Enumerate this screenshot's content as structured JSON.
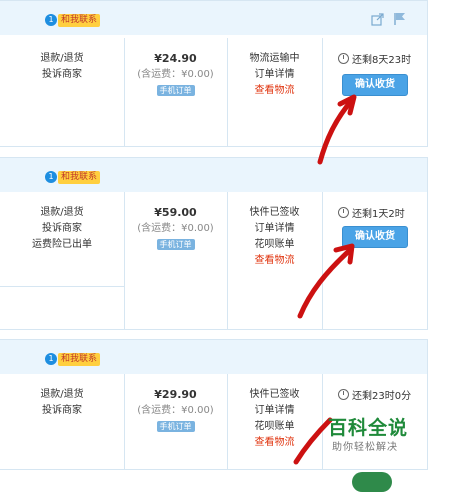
{
  "contact_label": "和我联系",
  "orders": [
    {
      "actions": [
        "退款/退货",
        "投诉商家"
      ],
      "price": "¥24.90",
      "shipping": "(含运费：¥0.00)",
      "mobile_badge": "手机订单",
      "status": [
        "物流运输中",
        "订单详情"
      ],
      "status_link": "查看物流",
      "countdown": "还剩8天23时",
      "confirm_label": "确认收货"
    },
    {
      "actions": [
        "退款/退货",
        "投诉商家",
        "运费险已出单"
      ],
      "price": "¥59.00",
      "shipping": "(含运费：¥0.00)",
      "mobile_badge": "手机订单",
      "status": [
        "快件已签收",
        "订单详情",
        "花呗账单"
      ],
      "status_link": "查看物流",
      "countdown": "还剩1天2时",
      "confirm_label": "确认收货"
    },
    {
      "actions": [
        "退款/退货",
        "投诉商家"
      ],
      "price": "¥29.90",
      "shipping": "(含运费：¥0.00)",
      "mobile_badge": "手机订单",
      "status": [
        "快件已签收",
        "订单详情",
        "花呗账单"
      ],
      "status_link": "查看物流",
      "countdown": "还剩23时0分"
    }
  ],
  "watermark": {
    "title": "百科全说",
    "subtitle": "助你轻松解决"
  },
  "colors": {
    "header_bg": "#eaf5fd",
    "confirm_bg": "#4aa3e6",
    "link_red": "#e0340f",
    "arrow_red": "#cc1111",
    "watermark_green": "#1f8a3a"
  },
  "icons": [
    "share-icon",
    "flag-icon",
    "clock-icon",
    "wangwang-icon"
  ]
}
